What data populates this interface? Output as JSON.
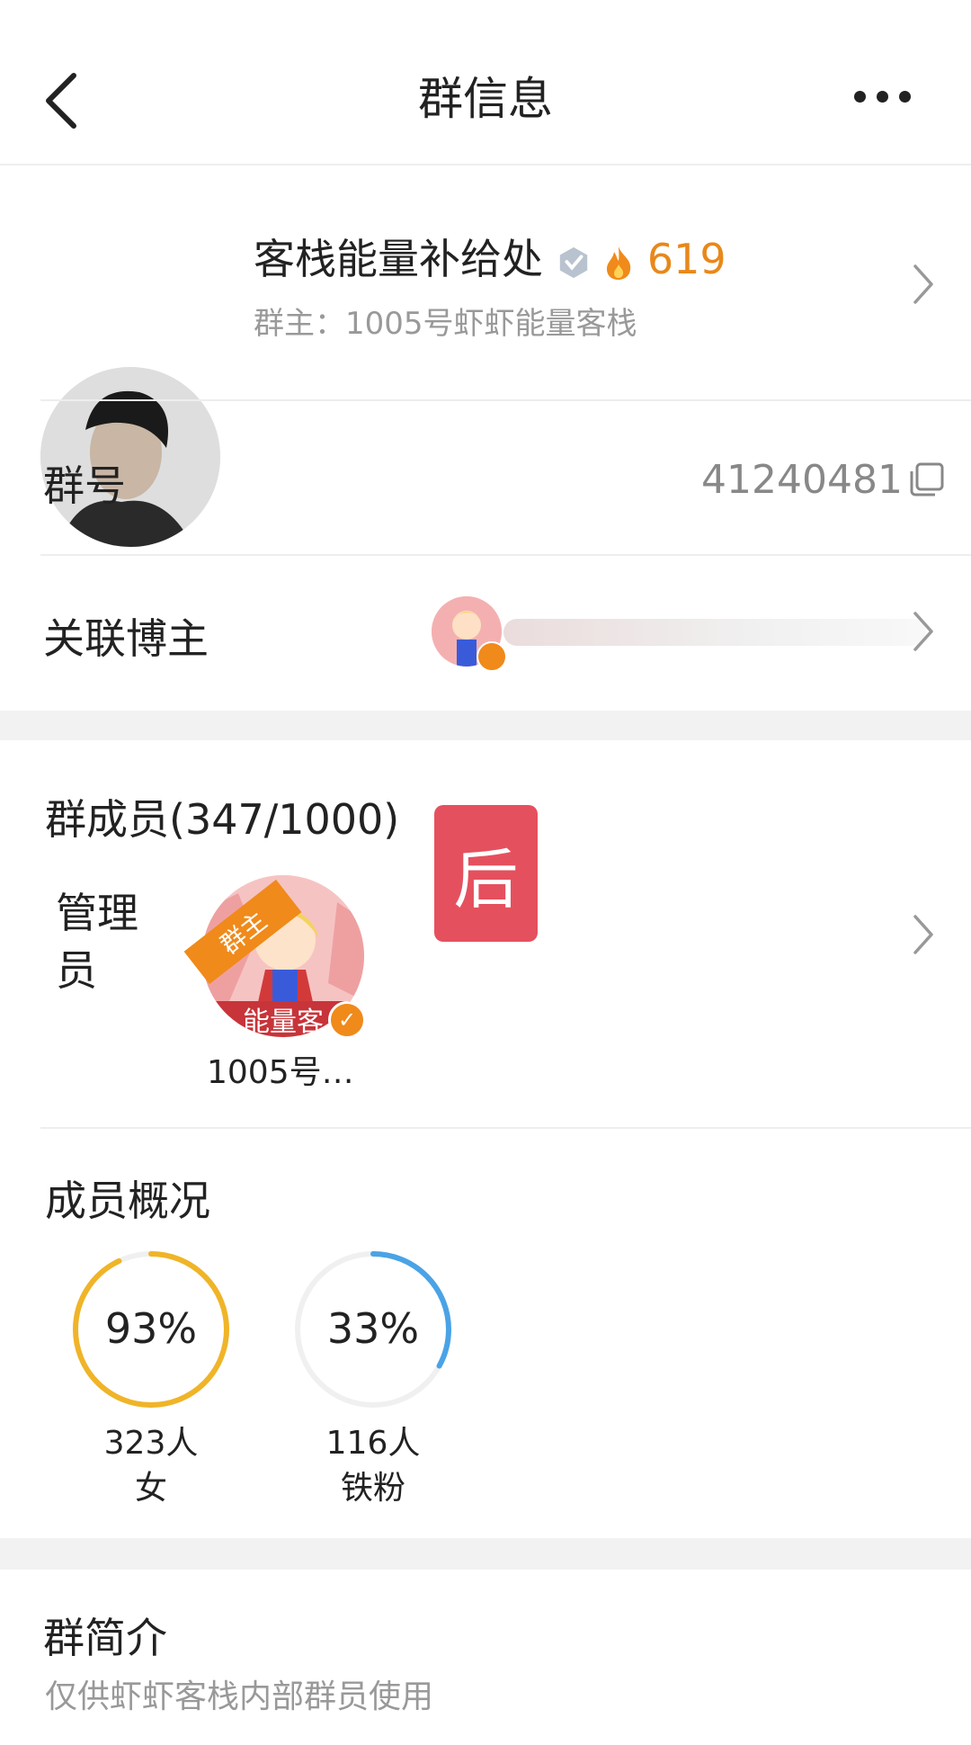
{
  "header": {
    "title": "群信息"
  },
  "group": {
    "name": "客栈能量补给处",
    "fire_count": "619",
    "owner_label": "群主：",
    "owner_name": "1005号虾虾能量客栈"
  },
  "rows": {
    "group_id_label": "群号",
    "group_id_value": "41240481",
    "linked_blogger_label": "关联博主"
  },
  "members": {
    "title": "群成员(347/1000)",
    "admin_label": "管理员",
    "owner_tag": "群主",
    "admin_name": "1005号…",
    "overlay_badge": "后",
    "avatar_text": "能量客"
  },
  "overview": {
    "title": "成员概况",
    "stats": [
      {
        "percent": "93%",
        "value": 0.93,
        "count": "323人",
        "label": "女",
        "color": "#f0b428"
      },
      {
        "percent": "33%",
        "value": 0.33,
        "count": "116人",
        "label": "铁粉",
        "color": "#4aa3e6"
      }
    ]
  },
  "intro": {
    "title": "群简介",
    "text": "仅供虾虾客栈内部群员使用"
  },
  "colors": {
    "accent_orange": "#e8881a",
    "badge_red": "#e5505e",
    "gap_gray": "#f2f2f2"
  }
}
